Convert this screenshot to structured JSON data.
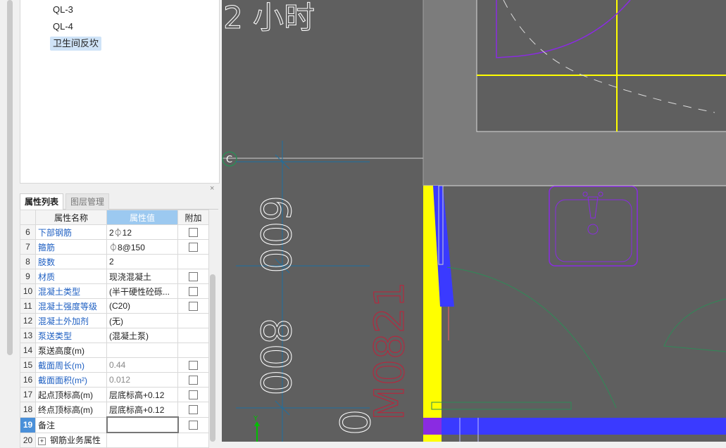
{
  "tree": {
    "items": [
      {
        "label": "QL-3",
        "selected": false
      },
      {
        "label": "QL-4",
        "selected": false
      },
      {
        "label": "卫生间反坎",
        "selected": true
      }
    ]
  },
  "panel": {
    "close_icon": "×",
    "tabs": [
      {
        "label": "属性列表",
        "active": true
      },
      {
        "label": "图层管理",
        "active": false
      }
    ]
  },
  "grid": {
    "headers": {
      "name": "属性名称",
      "value": "属性值",
      "extra": "附加"
    },
    "rows": [
      {
        "num": "6",
        "name": "下部钢筋",
        "value": "2⏀12",
        "link": true,
        "checkbox": true
      },
      {
        "num": "7",
        "name": "箍筋",
        "value": "⏀8@150",
        "link": true,
        "checkbox": true
      },
      {
        "num": "8",
        "name": "肢数",
        "value": "2",
        "link": true,
        "checkbox": false
      },
      {
        "num": "9",
        "name": "材质",
        "value": "现浇混凝土",
        "link": true,
        "checkbox": true
      },
      {
        "num": "10",
        "name": "混凝土类型",
        "value": "(半干硬性砼砾...",
        "link": true,
        "checkbox": true
      },
      {
        "num": "11",
        "name": "混凝土强度等级",
        "value": "(C20)",
        "link": true,
        "checkbox": true
      },
      {
        "num": "12",
        "name": "混凝土外加剂",
        "value": "(无)",
        "link": true,
        "checkbox": false
      },
      {
        "num": "13",
        "name": "泵送类型",
        "value": "(混凝土泵)",
        "link": true,
        "checkbox": false
      },
      {
        "num": "14",
        "name": "泵送高度(m)",
        "value": "",
        "link": false,
        "checkbox": false
      },
      {
        "num": "15",
        "name": "截面周长(m)",
        "value": "0.44",
        "link": true,
        "gray": true,
        "checkbox": true
      },
      {
        "num": "16",
        "name": "截面面积(m²)",
        "value": "0.012",
        "link": true,
        "gray": true,
        "checkbox": true
      },
      {
        "num": "17",
        "name": "起点顶标高(m)",
        "value": "层底标高+0.12",
        "link": false,
        "checkbox": true
      },
      {
        "num": "18",
        "name": "终点顶标高(m)",
        "value": "层底标高+0.12",
        "link": false,
        "checkbox": true
      },
      {
        "num": "19",
        "name": "备注",
        "value": "",
        "link": false,
        "current": true,
        "edit": true,
        "checkbox": true
      },
      {
        "num": "20",
        "name": "钢筋业务属性",
        "value": "",
        "link": false,
        "expand": true,
        "checkbox": false
      }
    ]
  },
  "cad": {
    "axis_marker": "C",
    "dim_600": "600",
    "dim_800": "800",
    "dim_partial": "0",
    "door_label": "M0821",
    "top_text": "2 小时",
    "y_axis_label": "Y"
  }
}
